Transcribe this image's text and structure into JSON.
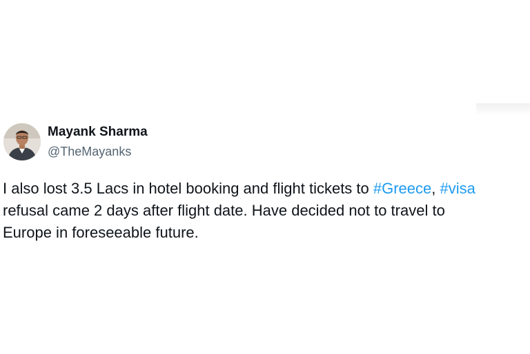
{
  "tweet": {
    "author": {
      "name": "Mayank Sharma",
      "handle": "@TheMayanks"
    },
    "text": {
      "line1_part1": "I also lost 3.5 Lacs in hotel booking and flight tickets to ",
      "hashtag_greece": "#Greece",
      "line1_sep": ", ",
      "hashtag_visa": "#visa",
      "line2": "refusal came 2 days after flight date. Have decided not to travel to",
      "line3": "Europe in foreseeable future."
    }
  },
  "colors": {
    "name_text": "#0f1419",
    "handle_text": "#536471",
    "hashtag_link": "#1d9bf0",
    "background": "#ffffff"
  }
}
